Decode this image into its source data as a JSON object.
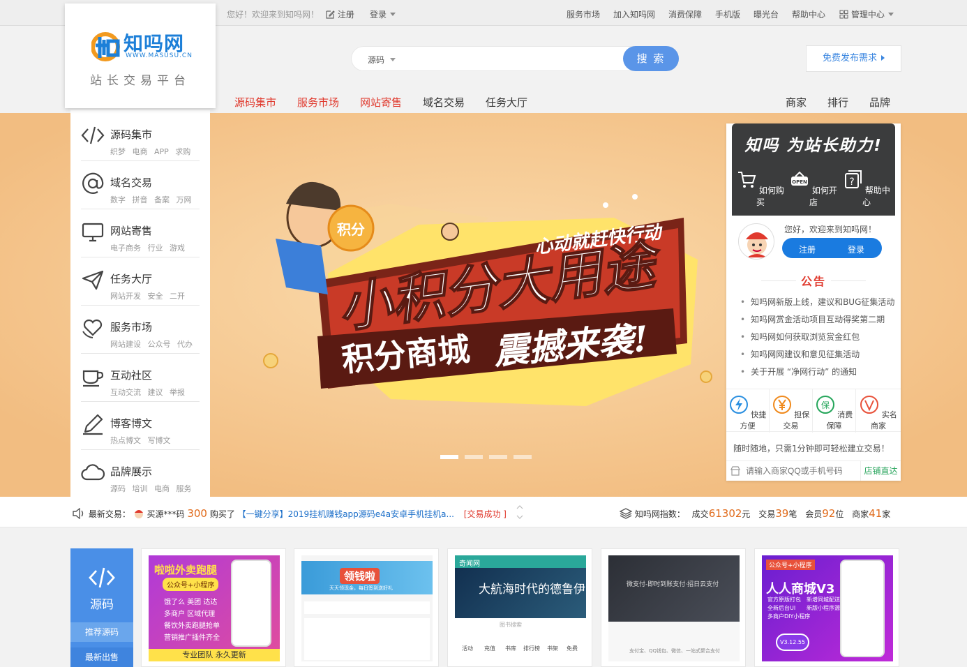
{
  "topbar": {
    "welcome": "您好！欢迎来到知吗网！",
    "register": "注册",
    "login": "登录",
    "links": [
      "服务市场",
      "加入知吗网",
      "消费保障",
      "手机版",
      "曝光台",
      "帮助中心"
    ],
    "admin": "管理中心"
  },
  "logo": {
    "brand": "知吗网",
    "domain": "WWW.MASUSU.CN",
    "slogan": "站长交易平台"
  },
  "search": {
    "category": "源码",
    "placeholder": "",
    "button": "搜 索"
  },
  "publish_button": "免费发布需求",
  "nav": {
    "main": [
      "源码集市",
      "服务市场",
      "网站寄售",
      "域名交易",
      "任务大厅"
    ],
    "right": [
      "商家",
      "排行",
      "品牌"
    ]
  },
  "categories": [
    {
      "title": "源码集市",
      "sub": "织梦 电商 APP 求购",
      "icon": "code-icon"
    },
    {
      "title": "域名交易",
      "sub": "数字 拼音 备案 万网",
      "icon": "at-icon"
    },
    {
      "title": "网站寄售",
      "sub": "电子商务 行业 游戏",
      "icon": "monitor-icon"
    },
    {
      "title": "任务大厅",
      "sub": "网站开发 安全 二开",
      "icon": "paper-plane-icon"
    },
    {
      "title": "服务市场",
      "sub": "网站建设 公众号 代办",
      "icon": "heart-hand-icon"
    },
    {
      "title": "互动社区",
      "sub": "互动交流 建议 举报",
      "icon": "cup-icon"
    },
    {
      "title": "博客博文",
      "sub": "热点博文 写博文",
      "icon": "pencil-icon"
    },
    {
      "title": "品牌展示",
      "sub": "源码 培训 电商 服务",
      "icon": "cloud-icon"
    }
  ],
  "banner": {
    "coin_label": "积分",
    "tagline": "心动就赶快行动",
    "headline": "小积分大用途",
    "subline": "积分商城",
    "script": "震撼来袭!",
    "slide_count": 4,
    "active_slide": 1
  },
  "panel": {
    "title": "知吗 为站长助力!",
    "help_items": [
      {
        "label": "如何购买",
        "icon": "cart-icon"
      },
      {
        "label": "如何开店",
        "icon": "open-sign-icon"
      },
      {
        "label": "帮助中心",
        "icon": "question-icon"
      }
    ],
    "greeting": "您好，欢迎来到知吗网！",
    "register": "注册",
    "login": "登录",
    "notice_title": "公告",
    "notices": [
      "知吗网新版上线，建议和BUG征集活动",
      "知吗网赏金活动项目互动得奖第二期",
      "知吗网如何获取浏览赏金红包",
      "知吗网网建议和意见征集活动",
      "关于开展 “净网行动” 的通知"
    ],
    "features": [
      {
        "label": "快捷方便",
        "icon": "lightning-icon",
        "color": "#2a8fe0"
      },
      {
        "label": "担保交易",
        "icon": "yen-icon",
        "color": "#f08a1d"
      },
      {
        "label": "消费保障",
        "icon": "shield-icon",
        "color": "#26a65b"
      },
      {
        "label": "实名商家",
        "icon": "verified-icon",
        "color": "#e8513a"
      }
    ],
    "tip": "随时随地，只需1分钟即可轻松建立交易！",
    "qq_placeholder": "请输入商家QQ或手机号码",
    "qq_button": "店铺直达"
  },
  "ticker": {
    "label": "最新交易：",
    "buyer": "买源***码",
    "amount": "300",
    "action": "购买了",
    "item": "【一键分享】2019挂机赚钱app源码e4a安卓手机挂机a...",
    "status": "[交易成功 ]",
    "index_label": "知吗网指数：",
    "deal_label": "成交",
    "deal_value": "61302",
    "deal_unit": "元",
    "trade_label": "交易",
    "trade_value": "39",
    "trade_unit": "笔",
    "member_label": "会员",
    "member_value": "92",
    "member_unit": "位",
    "merchant_label": "商家",
    "merchant_value": "41",
    "merchant_unit": "家"
  },
  "source_box": {
    "label": "源码",
    "tab_recommended": "推荐源码",
    "tab_latest": "最新出售"
  },
  "tiles": [
    {
      "title": "啦啦外卖跑腿",
      "badge": "公众号+小程序",
      "lines": [
        "饿了么 美团 达达",
        "多商户 区域代理",
        "餐饮外卖跑腿抢单",
        "营销推广插件齐全"
      ],
      "footer": "专业团队 永久更新"
    },
    {
      "banner": "领钱啦",
      "sub": "天天领现金，每日签到送好礼"
    },
    {
      "logo": "奇闻网",
      "headline": "大航海时代的德鲁伊",
      "search_hint": "图书搜索",
      "icons": [
        "活动",
        "充值",
        "书库",
        "排行榜",
        "书架",
        "免费"
      ]
    },
    {
      "headline": "微支付-即时到账支付·招日云支付",
      "sub": "支付宝、QQ钱包、微信、一站式聚合支付"
    },
    {
      "badge": "公众号+小程序",
      "headline": "人人商城V3",
      "lines": [
        "官方原版打包",
        "新增同城配送",
        "全新后台UI",
        "新版小程序源码",
        "多商户DIY小程序"
      ],
      "version": "V3.12.55"
    }
  ],
  "colors": {
    "brand_blue": "#1c7fd8",
    "accent_red": "#e0392d",
    "banner_bg": "#f4c389",
    "button_blue": "#5a95e8"
  }
}
